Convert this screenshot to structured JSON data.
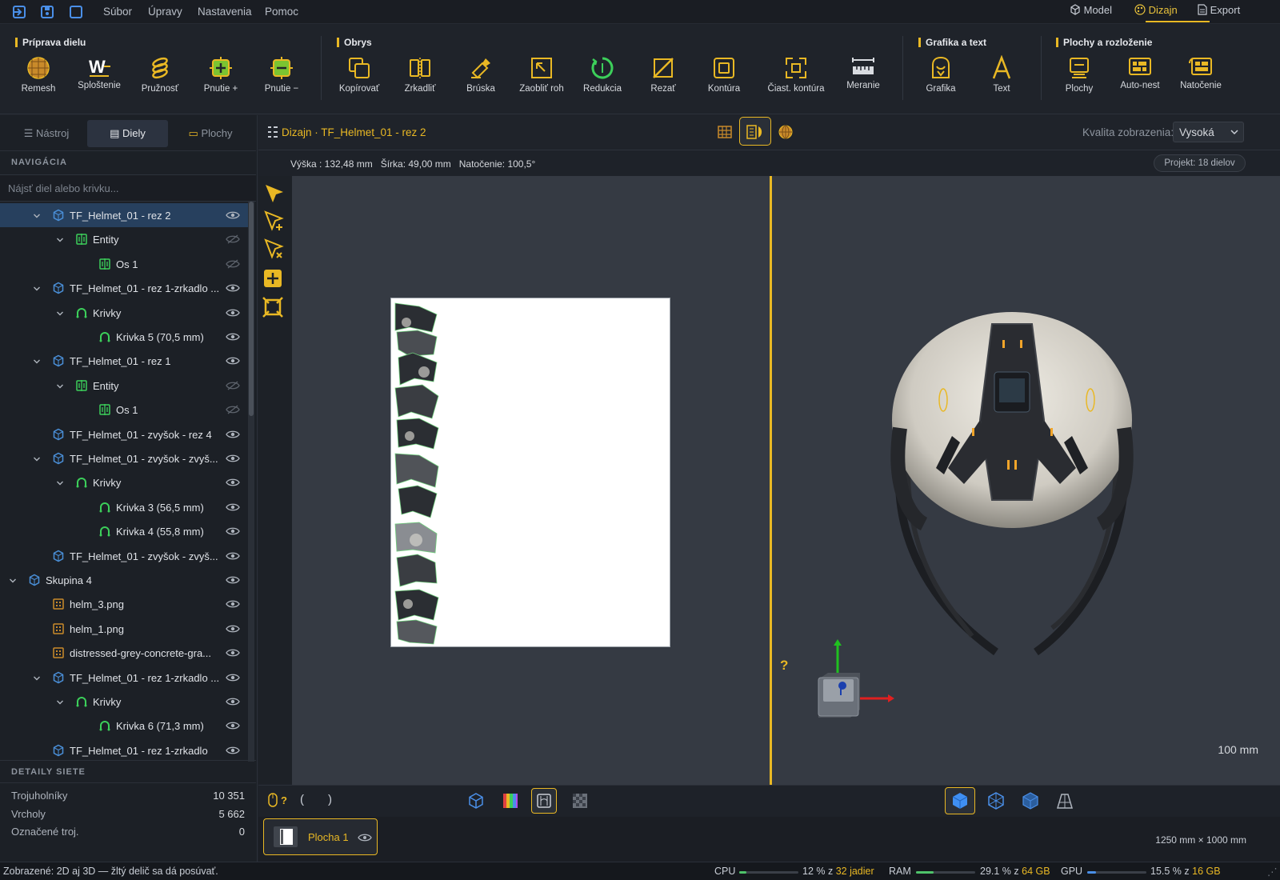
{
  "menubar": {
    "items": [
      "Súbor",
      "Úpravy",
      "Nastavenia",
      "Pomoc"
    ],
    "modes": [
      {
        "label": "Model",
        "icon": "cube-icon"
      },
      {
        "label": "Dizajn",
        "icon": "palette-icon",
        "active": true
      },
      {
        "label": "Export",
        "icon": "document-icon"
      }
    ]
  },
  "ribbon": {
    "groups": {
      "priprava": "Príprava dielu",
      "obrys": "Obrys",
      "grafika": "Grafika a text",
      "plochy": "Plochy a rozloženie"
    },
    "tools": {
      "remesh": "Remesh",
      "splostenie": "Sploštenie",
      "pruznost": "Pružnosť",
      "pnutie_plus": "Pnutie +",
      "pnutie_minus": "Pnutie −",
      "kopirovat": "Kopírovať",
      "zrkadlit": "Zrkadliť",
      "bruska": "Brúska",
      "zaoblit_roh": "Zaobliť roh",
      "redukcia": "Redukcia",
      "rezat": "Rezať",
      "kontura": "Kontúra",
      "ciast_kontura": "Čiast. kontúra",
      "meranie": "Meranie",
      "grafika": "Grafika",
      "text": "Text",
      "plochy": "Plochy",
      "auto_nest": "Auto-nest",
      "natocenie": "Natočenie"
    }
  },
  "leftpanel": {
    "tabs": [
      "Nástroj",
      "Diely",
      "Plochy"
    ],
    "active_tab": "Diely",
    "nav_header": "NAVIGÁCIA",
    "search_placeholder": "Nájsť diel alebo krivku...",
    "tree": [
      {
        "label": "TF_Helmet_01 - rez 2",
        "level": 1,
        "icon": "part-icon",
        "expanded": true,
        "selected": true,
        "visible": true
      },
      {
        "label": "Entity",
        "level": 2,
        "icon": "entity-icon",
        "expanded": true,
        "visible": false
      },
      {
        "label": "Os 1",
        "level": 3,
        "icon": "entity-icon",
        "visible": false
      },
      {
        "label": "TF_Helmet_01 - rez 1-zrkadlo ...",
        "level": 1,
        "icon": "part-icon",
        "expanded": true,
        "visible": true
      },
      {
        "label": "Krivky",
        "level": 2,
        "icon": "curve-icon",
        "expanded": true,
        "visible": true
      },
      {
        "label": "Krivka 5  (70,5 mm)",
        "level": 3,
        "icon": "curve-icon",
        "visible": true
      },
      {
        "label": "TF_Helmet_01 - rez 1",
        "level": 1,
        "icon": "part-icon",
        "expanded": true,
        "visible": true
      },
      {
        "label": "Entity",
        "level": 2,
        "icon": "entity-icon",
        "expanded": true,
        "visible": false
      },
      {
        "label": "Os 1",
        "level": 3,
        "icon": "entity-icon",
        "visible": false
      },
      {
        "label": "TF_Helmet_01 - zvyšok - rez 4",
        "level": 1,
        "icon": "part-icon",
        "visible": true
      },
      {
        "label": "TF_Helmet_01 - zvyšok - zvyš...",
        "level": 1,
        "icon": "part-icon",
        "expanded": true,
        "visible": true
      },
      {
        "label": "Krivky",
        "level": 2,
        "icon": "curve-icon",
        "expanded": true,
        "visible": true
      },
      {
        "label": "Krivka 3  (56,5 mm)",
        "level": 3,
        "icon": "curve-icon",
        "visible": true
      },
      {
        "label": "Krivka 4  (55,8 mm)",
        "level": 3,
        "icon": "curve-icon",
        "visible": true
      },
      {
        "label": "TF_Helmet_01 - zvyšok - zvyš...",
        "level": 1,
        "icon": "part-icon",
        "visible": true
      },
      {
        "label": "Skupina 4",
        "level": 0,
        "icon": "part-icon",
        "expanded": true,
        "visible": true
      },
      {
        "label": "helm_3.png",
        "level": 1,
        "icon": "image-icon",
        "visible": true
      },
      {
        "label": "helm_1.png",
        "level": 1,
        "icon": "image-icon",
        "visible": true
      },
      {
        "label": "distressed-grey-concrete-gra...",
        "level": 1,
        "icon": "image-icon",
        "visible": true
      },
      {
        "label": "TF_Helmet_01 - rez 1-zrkadlo ...",
        "level": 1,
        "icon": "part-icon",
        "expanded": true,
        "visible": true
      },
      {
        "label": "Krivky",
        "level": 2,
        "icon": "curve-icon",
        "expanded": true,
        "visible": true
      },
      {
        "label": "Krivka 6  (71,3 mm)",
        "level": 3,
        "icon": "curve-icon",
        "visible": true
      },
      {
        "label": "TF_Helmet_01 - rez 1-zrkadlo",
        "level": 1,
        "icon": "part-icon",
        "visible": true
      }
    ],
    "details_header": "DETAILY SIETE",
    "details": [
      {
        "label": "Trojuholníky",
        "value": "10 351"
      },
      {
        "label": "Vrcholy",
        "value": "5 662"
      },
      {
        "label": "Označené troj.",
        "value": "0"
      }
    ]
  },
  "center": {
    "title": "Dizajn · TF_Helmet_01 - rez 2",
    "quality_label": "Kvalita zobrazenia:",
    "quality_value": "Vysoká",
    "info": "Výška : 132,48 mm   Šírka: 49,00 mm   Natočenie: 100,5°",
    "project_badge": "Projekt: 18 dielov",
    "scale_label": "100 mm",
    "help_mark": "?",
    "sheet_label": "Plocha 1",
    "sheet_size": "1250 mm × 1000 mm"
  },
  "statusbar": {
    "message": "Zobrazené: 2D aj 3D — žltý delič sa dá posúvať.",
    "cpu_label": "CPU",
    "cpu_text": "12 % z ",
    "cpu_highlight": "32 jadier",
    "cpu_fraction": 0.12,
    "ram_label": "RAM",
    "ram_text": "29.1 % z ",
    "ram_highlight": "64 GB",
    "ram_fraction": 0.291,
    "gpu_label": "GPU",
    "gpu_text": "15.5 % z ",
    "gpu_highlight": "16 GB",
    "gpu_fraction": 0.155
  },
  "colors": {
    "accent": "#e9b824",
    "selection": "#27405e",
    "curve": "#3ccf5a",
    "part": "#4a8fd8"
  }
}
